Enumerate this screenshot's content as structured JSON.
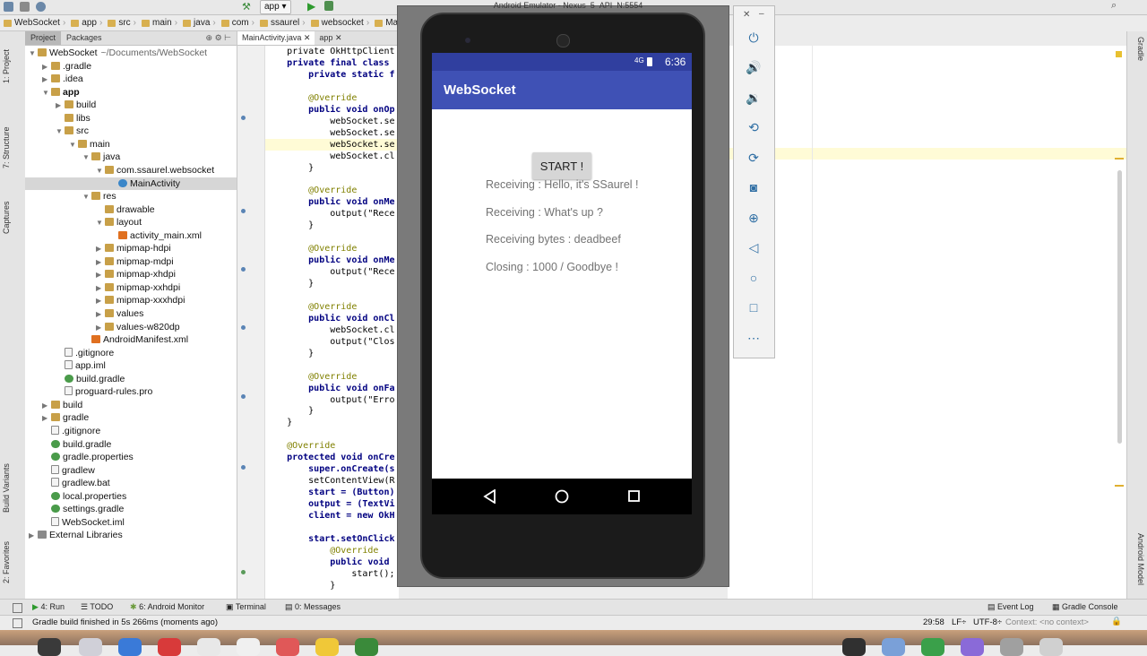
{
  "toolbar": {
    "run_config": "app",
    "nav": [
      "WebSocket",
      "app",
      "src",
      "main",
      "java",
      "com",
      "ssaurel",
      "websocket",
      "Mai"
    ]
  },
  "sidebar_left": {
    "tabs": [
      "1: Project",
      "7: Structure",
      "Captures",
      "Build Variants",
      "2: Favorites"
    ]
  },
  "project": {
    "tabs": [
      "Project",
      "Packages"
    ],
    "tree": [
      {
        "label": "WebSocket",
        "suffix": "~/Documents/WebSocket",
        "depth": 0,
        "icon": "folder",
        "open": true
      },
      {
        "label": ".gradle",
        "depth": 1,
        "icon": "folder",
        "open": false
      },
      {
        "label": ".idea",
        "depth": 1,
        "icon": "folder",
        "open": false
      },
      {
        "label": "app",
        "depth": 1,
        "icon": "folder",
        "open": true,
        "bold": true
      },
      {
        "label": "build",
        "depth": 2,
        "icon": "folder",
        "open": false
      },
      {
        "label": "libs",
        "depth": 2,
        "icon": "folder"
      },
      {
        "label": "src",
        "depth": 2,
        "icon": "folder",
        "open": true
      },
      {
        "label": "main",
        "depth": 3,
        "icon": "folder",
        "open": true
      },
      {
        "label": "java",
        "depth": 4,
        "icon": "folder",
        "open": true
      },
      {
        "label": "com.ssaurel.websocket",
        "depth": 5,
        "icon": "folder",
        "open": true
      },
      {
        "label": "MainActivity",
        "depth": 6,
        "icon": "java",
        "selected": true
      },
      {
        "label": "res",
        "depth": 4,
        "icon": "folder",
        "open": true
      },
      {
        "label": "drawable",
        "depth": 5,
        "icon": "folder"
      },
      {
        "label": "layout",
        "depth": 5,
        "icon": "folder",
        "open": true
      },
      {
        "label": "activity_main.xml",
        "depth": 6,
        "icon": "xml"
      },
      {
        "label": "mipmap-hdpi",
        "depth": 5,
        "icon": "folder",
        "open": false
      },
      {
        "label": "mipmap-mdpi",
        "depth": 5,
        "icon": "folder",
        "open": false
      },
      {
        "label": "mipmap-xhdpi",
        "depth": 5,
        "icon": "folder",
        "open": false
      },
      {
        "label": "mipmap-xxhdpi",
        "depth": 5,
        "icon": "folder",
        "open": false
      },
      {
        "label": "mipmap-xxxhdpi",
        "depth": 5,
        "icon": "folder",
        "open": false
      },
      {
        "label": "values",
        "depth": 5,
        "icon": "folder",
        "open": false
      },
      {
        "label": "values-w820dp",
        "depth": 5,
        "icon": "folder",
        "open": false
      },
      {
        "label": "AndroidManifest.xml",
        "depth": 4,
        "icon": "xml"
      },
      {
        "label": ".gitignore",
        "depth": 2,
        "icon": "file"
      },
      {
        "label": "app.iml",
        "depth": 2,
        "icon": "file"
      },
      {
        "label": "build.gradle",
        "depth": 2,
        "icon": "gradle"
      },
      {
        "label": "proguard-rules.pro",
        "depth": 2,
        "icon": "file"
      },
      {
        "label": "build",
        "depth": 1,
        "icon": "folder",
        "open": false
      },
      {
        "label": "gradle",
        "depth": 1,
        "icon": "folder",
        "open": false
      },
      {
        "label": ".gitignore",
        "depth": 1,
        "icon": "file"
      },
      {
        "label": "build.gradle",
        "depth": 1,
        "icon": "gradle"
      },
      {
        "label": "gradle.properties",
        "depth": 1,
        "icon": "gradle"
      },
      {
        "label": "gradlew",
        "depth": 1,
        "icon": "file"
      },
      {
        "label": "gradlew.bat",
        "depth": 1,
        "icon": "file"
      },
      {
        "label": "local.properties",
        "depth": 1,
        "icon": "gradle"
      },
      {
        "label": "settings.gradle",
        "depth": 1,
        "icon": "gradle"
      },
      {
        "label": "WebSocket.iml",
        "depth": 1,
        "icon": "file"
      },
      {
        "label": "External Libraries",
        "depth": 0,
        "icon": "lib",
        "open": false
      }
    ]
  },
  "editor": {
    "tabs": [
      "MainActivity.java",
      "app"
    ],
    "lines": [
      {
        "text": "    private OkHttpClient",
        "y": 0
      },
      {
        "text": "    private final class",
        "y": 1,
        "kw": true
      },
      {
        "text": "        private static f",
        "y": 2,
        "kw": true
      },
      {
        "text": "",
        "y": 3
      },
      {
        "text": "        @Override",
        "y": 4,
        "an": true
      },
      {
        "text": "        public void onOp",
        "y": 5,
        "kw": true
      },
      {
        "text": "            webSocket.se",
        "y": 6
      },
      {
        "text": "            webSocket.se",
        "y": 7
      },
      {
        "text": "            webSocket.se",
        "y": 8,
        "hl": true
      },
      {
        "text": "            webSocket.cl",
        "y": 9
      },
      {
        "text": "        }",
        "y": 10
      },
      {
        "text": "",
        "y": 11
      },
      {
        "text": "        @Override",
        "y": 12,
        "an": true
      },
      {
        "text": "        public void onMe",
        "y": 13,
        "kw": true
      },
      {
        "text": "            output(\"Rece",
        "y": 14,
        "st": true
      },
      {
        "text": "        }",
        "y": 15
      },
      {
        "text": "",
        "y": 16
      },
      {
        "text": "        @Override",
        "y": 17,
        "an": true
      },
      {
        "text": "        public void onMe",
        "y": 18,
        "kw": true
      },
      {
        "text": "            output(\"Rece",
        "y": 19,
        "st": true
      },
      {
        "text": "        }",
        "y": 20
      },
      {
        "text": "",
        "y": 21
      },
      {
        "text": "        @Override",
        "y": 22,
        "an": true
      },
      {
        "text": "        public void onCl",
        "y": 23,
        "kw": true
      },
      {
        "text": "            webSocket.cl",
        "y": 24
      },
      {
        "text": "            output(\"Clos",
        "y": 25,
        "st": true
      },
      {
        "text": "        }",
        "y": 26
      },
      {
        "text": "",
        "y": 27
      },
      {
        "text": "        @Override",
        "y": 28,
        "an": true
      },
      {
        "text": "        public void onFa",
        "y": 29,
        "kw": true
      },
      {
        "text": "            output(\"Erro",
        "y": 30,
        "st": true
      },
      {
        "text": "        }",
        "y": 31
      },
      {
        "text": "    }",
        "y": 32
      },
      {
        "text": "",
        "y": 33
      },
      {
        "text": "    @Override",
        "y": 34,
        "an": true
      },
      {
        "text": "    protected void onCre",
        "y": 35,
        "kw": true
      },
      {
        "text": "        super.onCreate(s",
        "y": 36,
        "kw": true
      },
      {
        "text": "        setContentView(R",
        "y": 37
      },
      {
        "text": "        start = (Button)",
        "y": 38,
        "kw": true
      },
      {
        "text": "        output = (TextVi",
        "y": 39,
        "kw": true
      },
      {
        "text": "        client = new OkH",
        "y": 40,
        "kw": true
      },
      {
        "text": "",
        "y": 41
      },
      {
        "text": "        start.setOnClick",
        "y": 42,
        "kw": true
      },
      {
        "text": "            @Override",
        "y": 43,
        "an": true
      },
      {
        "text": "            public void",
        "y": 44,
        "kw": true
      },
      {
        "text": "                start();",
        "y": 45
      },
      {
        "text": "            }",
        "y": 46
      }
    ]
  },
  "emulator": {
    "title": "Android Emulator - Nexus_5_API_N:5554",
    "status_time": "6:36",
    "network": "4G",
    "app_title": "WebSocket",
    "start_button": "START !",
    "output": [
      "Receiving : Hello, it's SSaurel !",
      "Receiving : What's up ?",
      "Receiving bytes : deadbeef",
      "Closing : 1000 / Goodbye !"
    ],
    "controls": [
      "power-icon",
      "volume-up-icon",
      "volume-down-icon",
      "rotate-left-icon",
      "rotate-right-icon",
      "camera-icon",
      "zoom-icon",
      "back-icon",
      "home-icon",
      "overview-icon",
      "more-icon"
    ]
  },
  "right_strip": {
    "tabs": [
      "Gradle",
      "Android Model"
    ]
  },
  "bottom_tools": {
    "run": "4: Run",
    "todo": "TODO",
    "monitor": "6: Android Monitor",
    "terminal": "Terminal",
    "messages": "0: Messages",
    "event_log": "Event Log",
    "gradle_console": "Gradle Console"
  },
  "status": {
    "message": "Gradle build finished in 5s 266ms (moments ago)",
    "position": "29:58",
    "line_sep": "LF÷",
    "encoding": "UTF-8÷",
    "context": "Context: <no context>"
  },
  "colors": {
    "app_bar": "#3f51b5",
    "status_bar": "#303f9f",
    "editor_highlight": "#fffbd6"
  }
}
